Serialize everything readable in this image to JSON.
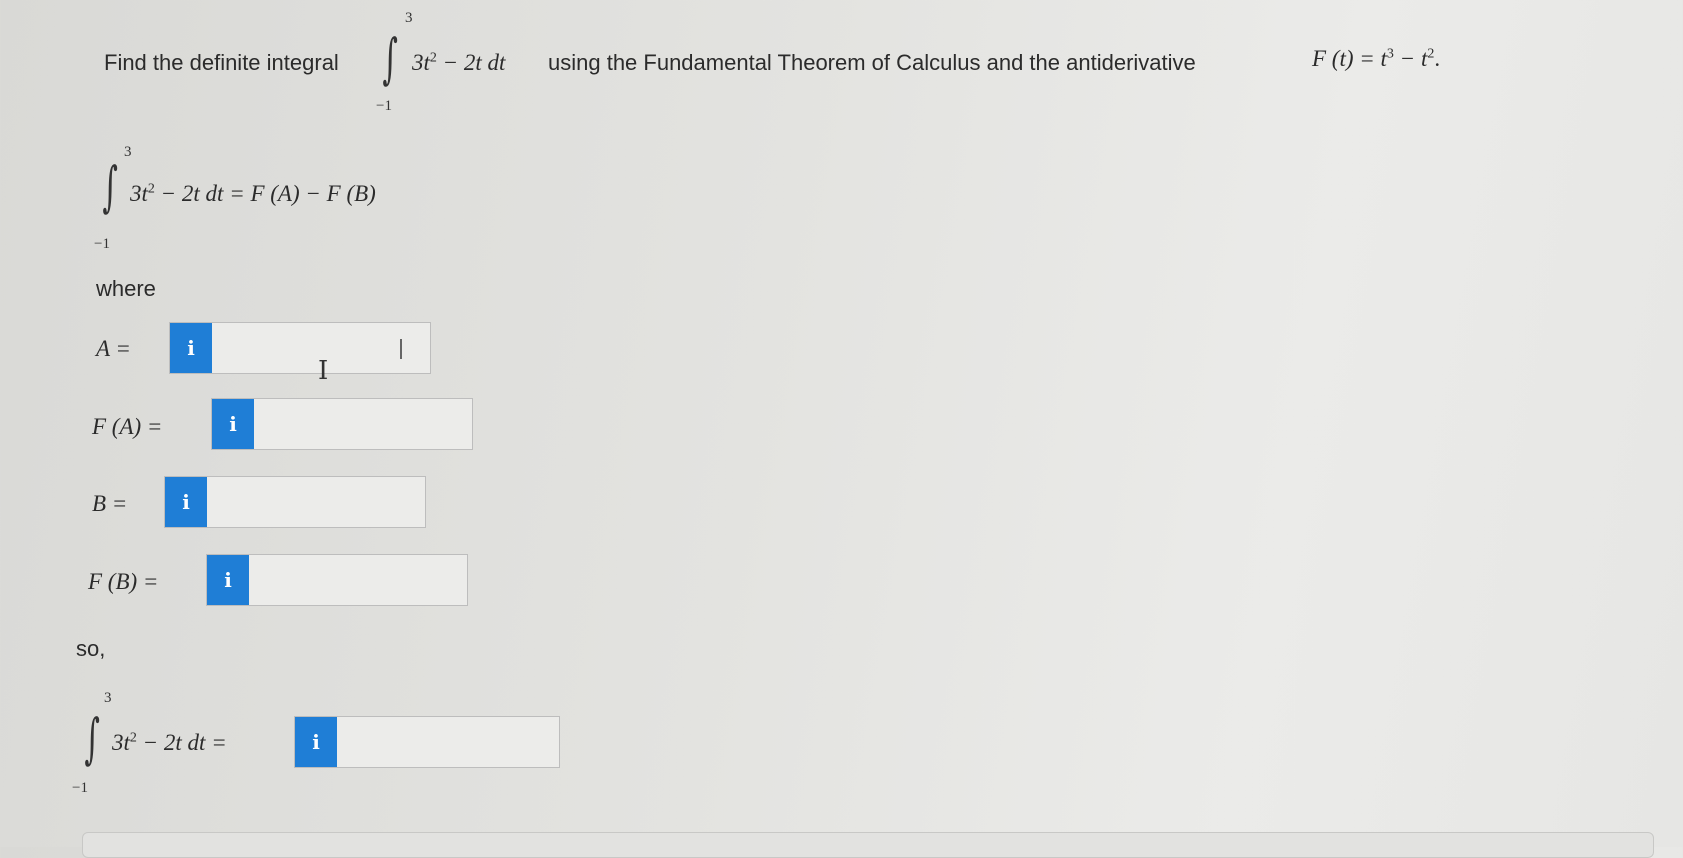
{
  "question": {
    "prefix": "Find the definite integral",
    "upper_limit": "3",
    "lower_limit": "−1",
    "integrand_coef": "3t",
    "integrand_exp": "2",
    "integrand_rest": " − 2t dt",
    "middle_text": "using the Fundamental Theorem of Calculus and the antiderivative",
    "antideriv_lhs": "F (t) = t",
    "antideriv_exp1": "3",
    "antideriv_mid": " − t",
    "antideriv_exp2": "2",
    "antideriv_end": "."
  },
  "formula": {
    "upper_limit": "3",
    "lower_limit": "−1",
    "integrand_coef": "3t",
    "integrand_exp": "2",
    "rhs": " − 2t dt = F (A) − F (B)"
  },
  "where_label": "where",
  "fields": [
    {
      "label": "A =",
      "icon": "info-icon",
      "icon_glyph": "i",
      "value": ""
    },
    {
      "label": "F (A) =",
      "icon": "info-icon",
      "icon_glyph": "i",
      "value": ""
    },
    {
      "label": "B =",
      "icon": "info-icon",
      "icon_glyph": "i",
      "value": ""
    },
    {
      "label": "F (B) =",
      "icon": "info-icon",
      "icon_glyph": "i",
      "value": ""
    }
  ],
  "so_label": "so,",
  "final": {
    "upper_limit": "3",
    "lower_limit": "−1",
    "integrand_coef": "3t",
    "integrand_exp": "2",
    "rhs": " − 2t dt =",
    "icon": "info-icon",
    "icon_glyph": "i",
    "value": ""
  },
  "colors": {
    "accent": "#1f7ed6",
    "background": "#e3e3e0",
    "text": "#2b2b2b"
  }
}
